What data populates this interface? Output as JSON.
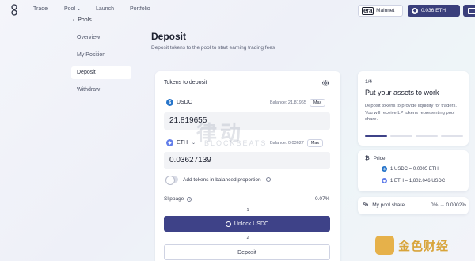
{
  "topnav": {
    "items": [
      {
        "label": "Trade"
      },
      {
        "label": "Pool"
      },
      {
        "label": "Launch"
      },
      {
        "label": "Portfolio"
      }
    ],
    "network": {
      "brand": "era",
      "label": "Mainnet"
    },
    "balance": "0.036 ETH"
  },
  "sidebar": {
    "back": "Pools",
    "items": [
      {
        "label": "Overview"
      },
      {
        "label": "My Position"
      },
      {
        "label": "Deposit"
      },
      {
        "label": "Withdraw"
      }
    ]
  },
  "page": {
    "title": "Deposit",
    "subtitle": "Deposit tokens to the pool to start earning trading fees"
  },
  "deposit_card": {
    "label": "Tokens to deposit",
    "tokens": [
      {
        "symbol": "USDC",
        "balance": "Balance: 21.81965",
        "max": "Max",
        "amount": "21.819655",
        "coin_color": "#2775ca"
      },
      {
        "symbol": "ETH",
        "balance": "Balance: 0.03627",
        "max": "Max",
        "amount": "0.03627139",
        "coin_color": "#627eea"
      }
    ],
    "balanced_toggle": "Add tokens in balanced proportion",
    "slippage_label": "Slippage",
    "slippage_value": "0.07%",
    "step1": "1",
    "unlock_button": "Unlock USDC",
    "step2": "2",
    "deposit_button": "Deposit"
  },
  "steps_card": {
    "count": "1/4",
    "title": "Put your assets to work",
    "description": "Deposit tokens to provide liquidity for traders. You will receive LP tokens representing pool share.",
    "progress_active": 1,
    "progress_total": 4
  },
  "price_card": {
    "title": "Price",
    "line1": "1 USDC = 0.0005 ETH",
    "line2": "1 ETH = 1,802.046 USDC"
  },
  "share_card": {
    "title": "My pool share",
    "value": "0% → 0.0002%"
  },
  "watermarks": {
    "center": "律动",
    "center_sub": "BLOCKBEATS",
    "corner": "金色财经"
  },
  "colors": {
    "primary": "#3e4288",
    "usdc": "#2775ca",
    "eth": "#627eea"
  }
}
